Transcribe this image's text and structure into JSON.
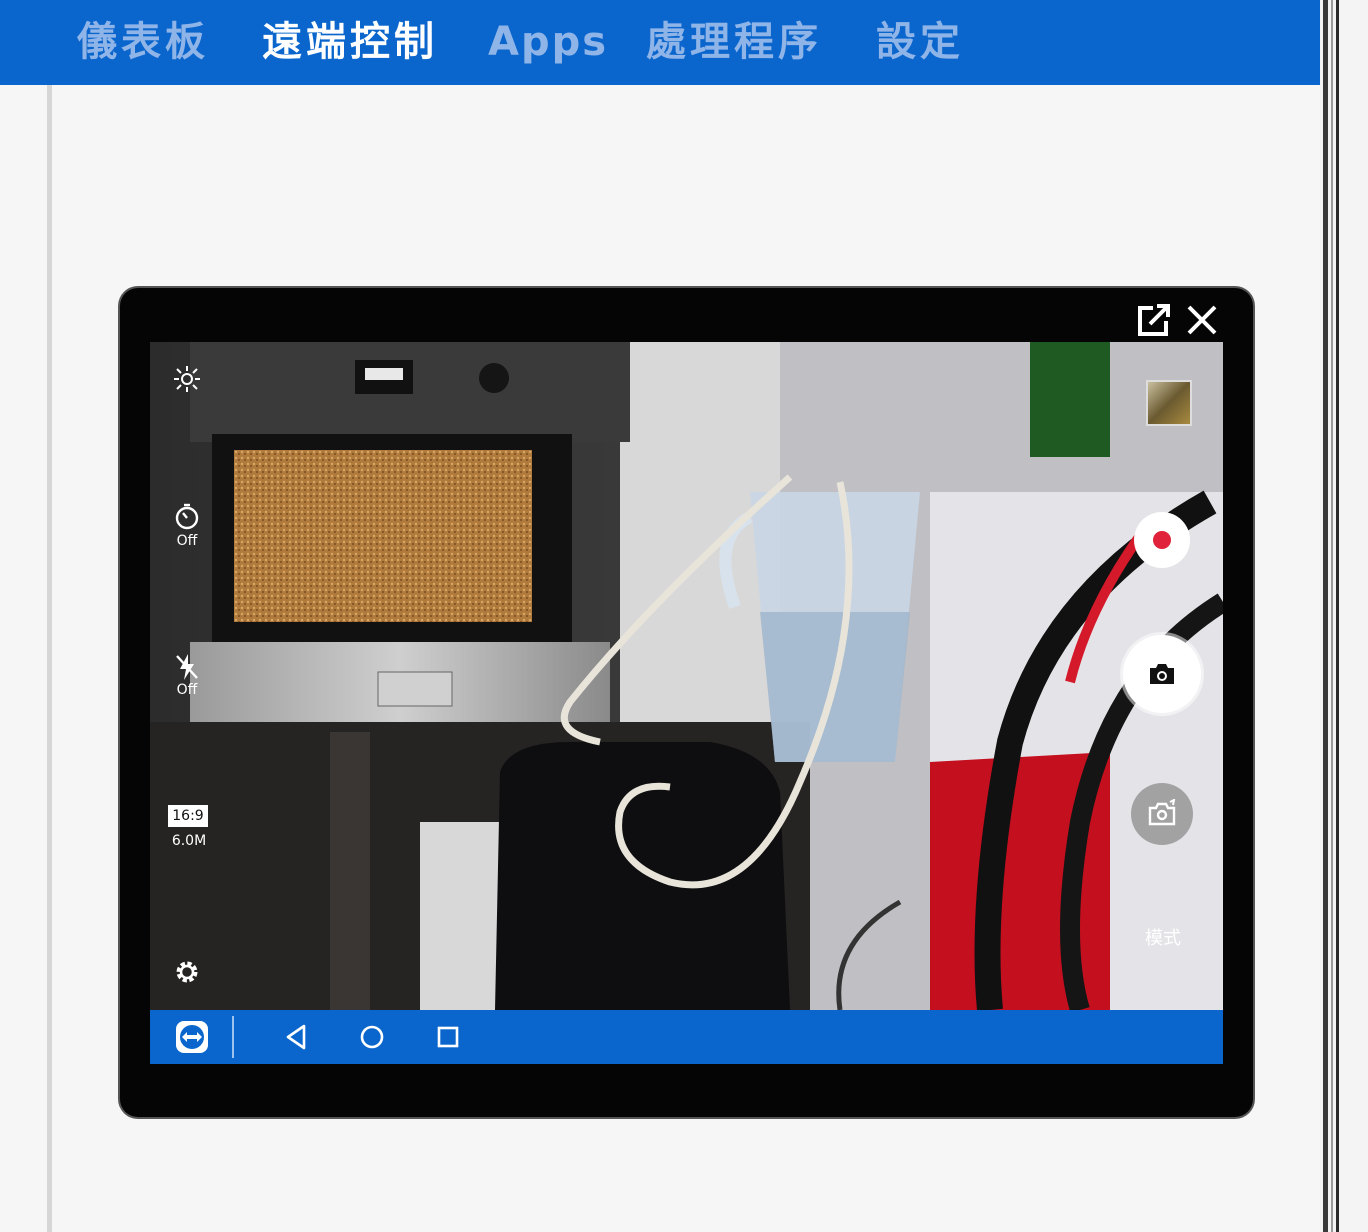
{
  "nav": {
    "tabs": [
      {
        "label": "儀表板",
        "active": false
      },
      {
        "label": "遠端控制",
        "active": true
      },
      {
        "label": "Apps",
        "active": false
      },
      {
        "label": "處理程序",
        "active": false
      },
      {
        "label": "設定",
        "active": false
      }
    ]
  },
  "window_controls": {
    "popout_icon": "external-window-icon",
    "close_icon": "close-icon"
  },
  "camera": {
    "timer_state": "Off",
    "flash_state": "Off",
    "aspect_ratio": "16:9",
    "resolution": "6.0M",
    "mode_label": "模式",
    "icons": [
      "brightness-icon",
      "timer-icon",
      "flash-off-icon",
      "settings-gear-icon",
      "gallery-thumbnail",
      "record-icon",
      "camera-shutter-icon",
      "switch-camera-icon"
    ]
  },
  "android_nav": {
    "icons": [
      "teamviewer-icon",
      "back-icon",
      "home-icon",
      "recents-icon"
    ]
  },
  "colors": {
    "brand_blue": "#0a66cc",
    "tab_inactive": "#8fb4e8",
    "record_red": "#e0223a"
  }
}
